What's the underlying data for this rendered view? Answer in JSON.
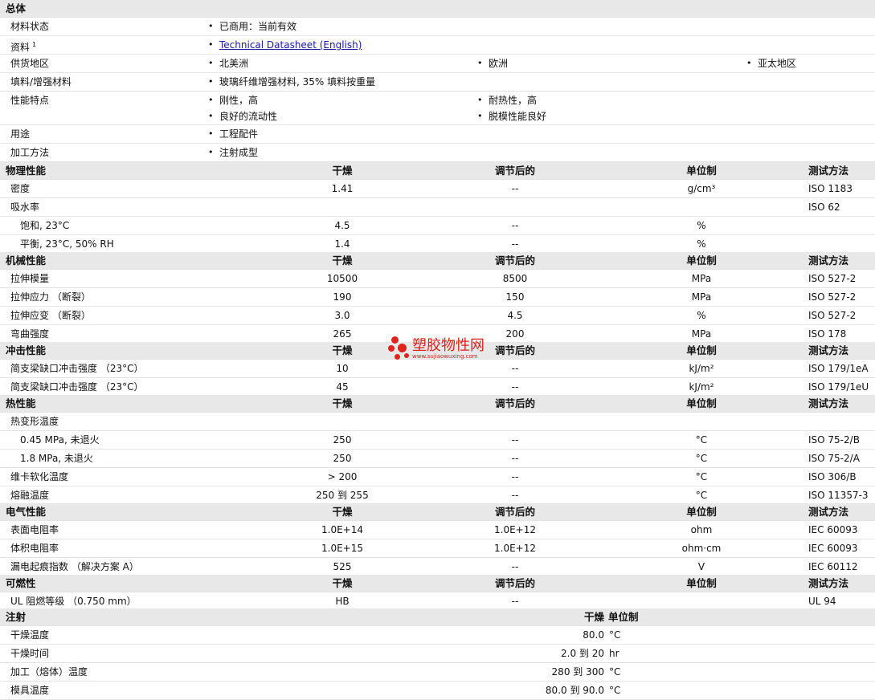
{
  "general": {
    "title": "总体",
    "status": {
      "label": "材料状态",
      "value": "已商用：当前有效"
    },
    "info": {
      "label": "资料",
      "footnote": "1",
      "link": "Technical Datasheet (English)"
    },
    "regions": {
      "label": "供货地区",
      "values": [
        "北美洲",
        "欧洲",
        "亚太地区"
      ]
    },
    "filler": {
      "label": "填料/增强材料",
      "value": "玻璃纤维增强材料, 35% 填料按重量"
    },
    "features": {
      "label": "性能特点",
      "values": [
        "刚性，高",
        "耐热性，高",
        "良好的流动性",
        "脱模性能良好"
      ]
    },
    "uses": {
      "label": "用途",
      "value": "工程配件"
    },
    "processing": {
      "label": "加工方法",
      "value": "注射成型"
    }
  },
  "headers": {
    "dry": "干燥",
    "conditioned": "调节后的",
    "unit": "单位制",
    "method": "测试方法"
  },
  "physical": {
    "title": "物理性能",
    "rows": [
      {
        "name": "密度",
        "dry": "1.41",
        "cond": "--",
        "unit": "g/cm³",
        "method": "ISO 1183"
      },
      {
        "name": "吸水率",
        "dry": "",
        "cond": "",
        "unit": "",
        "method": "ISO 62"
      },
      {
        "name": "饱和, 23°C",
        "dry": "4.5",
        "cond": "--",
        "unit": "%",
        "method": ""
      },
      {
        "name": "平衡, 23°C, 50% RH",
        "dry": "1.4",
        "cond": "--",
        "unit": "%",
        "method": ""
      }
    ]
  },
  "mechanical": {
    "title": "机械性能",
    "rows": [
      {
        "name": "拉伸模量",
        "dry": "10500",
        "cond": "8500",
        "unit": "MPa",
        "method": "ISO 527-2"
      },
      {
        "name": "拉伸应力 （断裂）",
        "dry": "190",
        "cond": "150",
        "unit": "MPa",
        "method": "ISO 527-2"
      },
      {
        "name": "拉伸应变 （断裂）",
        "dry": "3.0",
        "cond": "4.5",
        "unit": "%",
        "method": "ISO 527-2"
      },
      {
        "name": "弯曲强度",
        "dry": "265",
        "cond": "200",
        "unit": "MPa",
        "method": "ISO 178"
      }
    ]
  },
  "impact": {
    "title": "冲击性能",
    "rows": [
      {
        "name": "简支梁缺口冲击强度 （23°C）",
        "dry": "10",
        "cond": "--",
        "unit": "kJ/m²",
        "method": "ISO 179/1eA"
      },
      {
        "name": "简支梁缺口冲击强度 （23°C）",
        "dry": "45",
        "cond": "--",
        "unit": "kJ/m²",
        "method": "ISO 179/1eU"
      }
    ]
  },
  "thermal": {
    "title": "热性能",
    "rows": [
      {
        "name": "热变形温度",
        "dry": "",
        "cond": "",
        "unit": "",
        "method": ""
      },
      {
        "name": "0.45 MPa, 未退火",
        "dry": "250",
        "cond": "--",
        "unit": "°C",
        "method": "ISO 75-2/B"
      },
      {
        "name": "1.8 MPa, 未退火",
        "dry": "250",
        "cond": "--",
        "unit": "°C",
        "method": "ISO 75-2/A"
      },
      {
        "name": "维卡软化温度",
        "dry": "> 200",
        "cond": "--",
        "unit": "°C",
        "method": "ISO 306/B"
      },
      {
        "name": "熔融温度",
        "dry": "250 到  255",
        "cond": "--",
        "unit": "°C",
        "method": "ISO 11357-3"
      }
    ]
  },
  "electrical": {
    "title": "电气性能",
    "rows": [
      {
        "name": "表面电阻率",
        "dry": "1.0E+14",
        "cond": "1.0E+12",
        "unit": "ohm",
        "method": "IEC 60093"
      },
      {
        "name": "体积电阻率",
        "dry": "1.0E+15",
        "cond": "1.0E+12",
        "unit": "ohm·cm",
        "method": "IEC 60093"
      },
      {
        "name": "漏电起痕指数 （解决方案  A）",
        "dry": "525",
        "cond": "--",
        "unit": "V",
        "method": "IEC 60112"
      }
    ]
  },
  "flammability": {
    "title": "可燃性",
    "rows": [
      {
        "name": "UL 阻燃等级 （0.750 mm）",
        "dry": "HB",
        "cond": "--",
        "unit": "",
        "method": "UL 94"
      }
    ]
  },
  "injection": {
    "title": "注射",
    "dry": "干燥",
    "unit": "单位制",
    "rows": [
      {
        "name": "干燥温度",
        "value": "80.0",
        "unit": "°C"
      },
      {
        "name": "干燥时间",
        "value": "2.0 到  20",
        "unit": "hr"
      },
      {
        "name": "加工（熔体）温度",
        "value": "280 到  300",
        "unit": "°C"
      },
      {
        "name": "模具温度",
        "value": "80.0 到  90.0",
        "unit": "°C"
      }
    ]
  },
  "watermark": {
    "title": "塑胶物性网",
    "url": "www.sujiaowuxing.com"
  }
}
